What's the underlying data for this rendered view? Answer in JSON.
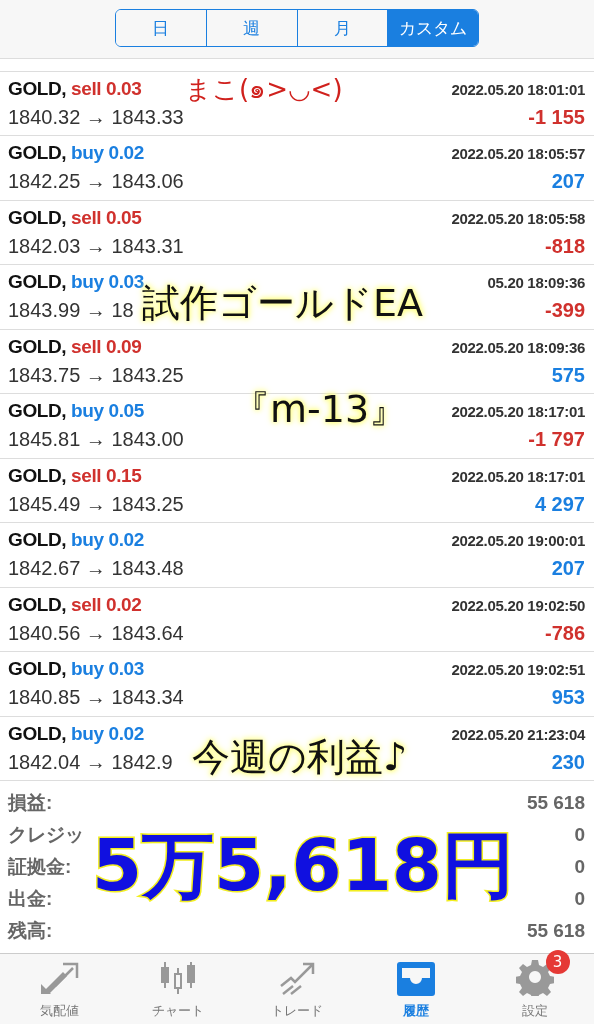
{
  "period_tabs": [
    {
      "label": "日",
      "selected": false
    },
    {
      "label": "週",
      "selected": false
    },
    {
      "label": "月",
      "selected": false
    },
    {
      "label": "カスタム",
      "selected": true
    }
  ],
  "trades": [
    {
      "symbol": "GOLD,",
      "kind": "sell",
      "order": "sell 0.03",
      "time": "2022.05.20 18:01:01",
      "prices": "1840.32 → 1843.33",
      "profit": "-1 155",
      "color": "#d0312d"
    },
    {
      "symbol": "GOLD,",
      "kind": "buy",
      "order": "buy 0.02",
      "time": "2022.05.20 18:05:57",
      "prices": "1842.25 → 1843.06",
      "profit": "207",
      "color": "#1a7fe0"
    },
    {
      "symbol": "GOLD,",
      "kind": "sell",
      "order": "sell 0.05",
      "time": "2022.05.20 18:05:58",
      "prices": "1842.03 → 1843.31",
      "profit": "-818",
      "color": "#d0312d"
    },
    {
      "symbol": "GOLD,",
      "kind": "buy",
      "order": "buy 0.03",
      "time": "05.20 18:09:36",
      "prices": "1843.99 → 18",
      "profit": "-399",
      "color": "#d0312d"
    },
    {
      "symbol": "GOLD,",
      "kind": "sell",
      "order": "sell 0.09",
      "time": "2022.05.20 18:09:36",
      "prices": "1843.75 → 1843.25",
      "profit": "575",
      "color": "#1a7fe0"
    },
    {
      "symbol": "GOLD,",
      "kind": "buy",
      "order": "buy 0.05",
      "time": "2022.05.20 18:17:01",
      "prices": "1845.81 → 1843.00",
      "profit": "-1 797",
      "color": "#d0312d"
    },
    {
      "symbol": "GOLD,",
      "kind": "sell",
      "order": "sell 0.15",
      "time": "2022.05.20 18:17:01",
      "prices": "1845.49 → 1843.25",
      "profit": "4 297",
      "color": "#1a7fe0"
    },
    {
      "symbol": "GOLD,",
      "kind": "buy",
      "order": "buy 0.02",
      "time": "2022.05.20 19:00:01",
      "prices": "1842.67 → 1843.48",
      "profit": "207",
      "color": "#1a7fe0"
    },
    {
      "symbol": "GOLD,",
      "kind": "sell",
      "order": "sell 0.02",
      "time": "2022.05.20 19:02:50",
      "prices": "1840.56 → 1843.64",
      "profit": "-786",
      "color": "#d0312d"
    },
    {
      "symbol": "GOLD,",
      "kind": "buy",
      "order": "buy 0.03",
      "time": "2022.05.20 19:02:51",
      "prices": "1840.85 → 1843.34",
      "profit": "953",
      "color": "#1a7fe0"
    },
    {
      "symbol": "GOLD,",
      "kind": "buy",
      "order": "buy 0.02",
      "time": "2022.05.20 21:23:04",
      "prices": "1842.04 → 1842.9",
      "profit": "230",
      "color": "#1a7fe0"
    }
  ],
  "summary": [
    {
      "label": "損益:",
      "value": "55 618"
    },
    {
      "label": "クレジッ",
      "value": "0"
    },
    {
      "label": "証拠金:",
      "value": "0"
    },
    {
      "label": "出金:",
      "value": "0"
    },
    {
      "label": "残高:",
      "value": "55 618"
    }
  ],
  "tab_bar": [
    {
      "label": "気配値",
      "kind": "quotes",
      "selected": false
    },
    {
      "label": "チャート",
      "kind": "chart",
      "selected": false
    },
    {
      "label": "トレード",
      "kind": "trade",
      "selected": false
    },
    {
      "label": "履歴",
      "kind": "history",
      "selected": true
    },
    {
      "label": "設定",
      "kind": "settings",
      "selected": false,
      "badge": "3"
    }
  ],
  "annotations": [
    {
      "text": "まこ(๑>◡<)",
      "kind": "signature"
    },
    {
      "text": "試作ゴールドEA",
      "kind": "note"
    },
    {
      "text": "『m-13』",
      "kind": "note"
    },
    {
      "text": "今週の利益♪",
      "kind": "note"
    },
    {
      "text": "5万5,618円",
      "kind": "total"
    }
  ]
}
